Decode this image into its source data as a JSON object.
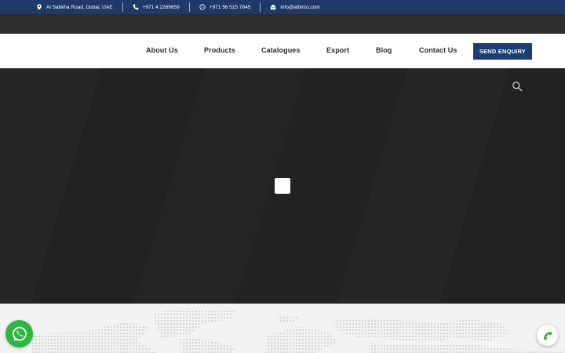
{
  "topbar": {
    "address": "Al Sabkha Road, Dubai, UAE",
    "phone": "+971 4 2269659",
    "whatsapp": "+971 56 515 7845",
    "email": "info@albirco.com"
  },
  "nav": {
    "items": [
      "About Us",
      "Products",
      "Catalogues",
      "Export",
      "Blog",
      "Contact Us"
    ],
    "cta": "SEND ENQUIRY"
  },
  "icons": {
    "address": "map-pin-icon",
    "phone": "phone-icon",
    "whatsapp": "whatsapp-icon",
    "email": "envelope-icon",
    "search": "search-icon",
    "chat": "whatsapp-icon",
    "call": "phone-icon"
  },
  "colors": {
    "topbar": "#1e3a6b",
    "cta": "#1c3d73",
    "hero": "#222222",
    "whatsapp": "#2db742",
    "call_icon": "#2db742"
  }
}
